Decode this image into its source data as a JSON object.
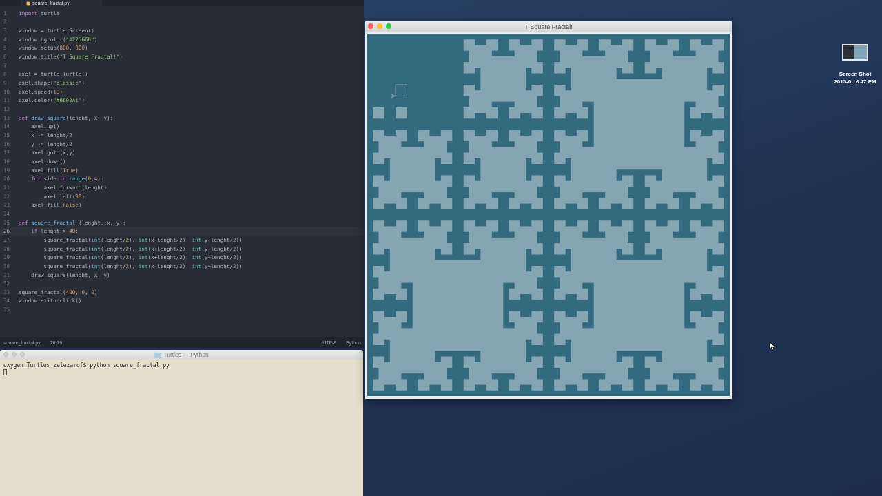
{
  "editor": {
    "tab": {
      "label": "square_fractal.py",
      "selected": true
    },
    "lines": [
      {
        "num": "1",
        "current": false,
        "tokens": [
          {
            "kind": "keyword",
            "text": "import"
          },
          {
            "kind": "plain",
            "text": " turtle"
          }
        ]
      },
      {
        "num": "2",
        "current": false
      },
      {
        "num": "3",
        "current": false,
        "tokens": [
          {
            "kind": "plain",
            "text": "window = turtle.Screen()"
          }
        ]
      },
      {
        "num": "4",
        "current": false,
        "tokens": [
          {
            "kind": "plain",
            "text": "window.bgcolor("
          },
          {
            "kind": "string",
            "text": "\"#27566B\""
          },
          {
            "kind": "plain",
            "text": ")"
          }
        ]
      },
      {
        "num": "5",
        "current": false,
        "tokens": [
          {
            "kind": "plain",
            "text": "window.setup("
          },
          {
            "kind": "number",
            "text": "800"
          },
          {
            "kind": "plain",
            "text": ", "
          },
          {
            "kind": "number",
            "text": "800"
          },
          {
            "kind": "plain",
            "text": ")"
          }
        ]
      },
      {
        "num": "6",
        "current": false,
        "tokens": [
          {
            "kind": "plain",
            "text": "window.title("
          },
          {
            "kind": "string",
            "text": "\"T Square Fractal!\""
          },
          {
            "kind": "plain",
            "text": ")"
          }
        ]
      },
      {
        "num": "7",
        "current": false
      },
      {
        "num": "8",
        "current": false,
        "tokens": [
          {
            "kind": "plain",
            "text": "axel = turtle.Turtle()"
          }
        ]
      },
      {
        "num": "9",
        "current": false,
        "tokens": [
          {
            "kind": "plain",
            "text": "axel.shape("
          },
          {
            "kind": "string",
            "text": "\"classic\""
          },
          {
            "kind": "plain",
            "text": ")"
          }
        ]
      },
      {
        "num": "10",
        "current": false,
        "tokens": [
          {
            "kind": "plain",
            "text": "axel.speed("
          },
          {
            "kind": "number",
            "text": "10"
          },
          {
            "kind": "plain",
            "text": ")"
          }
        ]
      },
      {
        "num": "11",
        "current": false,
        "tokens": [
          {
            "kind": "plain",
            "text": "axel.color("
          },
          {
            "kind": "string",
            "text": "\"#6E92A1\""
          },
          {
            "kind": "plain",
            "text": ")"
          }
        ]
      },
      {
        "num": "12",
        "current": false
      },
      {
        "num": "13",
        "current": false,
        "tokens": [
          {
            "kind": "keyword",
            "text": "def "
          },
          {
            "kind": "function",
            "text": "draw_square"
          },
          {
            "kind": "plain",
            "text": "(lenght, x, y):"
          }
        ]
      },
      {
        "num": "14",
        "current": false,
        "tokens": [
          {
            "kind": "plain",
            "text": "    axel.up()"
          }
        ]
      },
      {
        "num": "15",
        "current": false,
        "tokens": [
          {
            "kind": "plain",
            "text": "    x -= lenght/"
          },
          {
            "kind": "number",
            "text": "2"
          }
        ]
      },
      {
        "num": "16",
        "current": false,
        "tokens": [
          {
            "kind": "plain",
            "text": "    y -= lenght/"
          },
          {
            "kind": "number",
            "text": "2"
          }
        ]
      },
      {
        "num": "17",
        "current": false,
        "tokens": [
          {
            "kind": "plain",
            "text": "    axel.goto(x,y)"
          }
        ]
      },
      {
        "num": "18",
        "current": false,
        "tokens": [
          {
            "kind": "plain",
            "text": "    axel.down()"
          }
        ]
      },
      {
        "num": "19",
        "current": false,
        "tokens": [
          {
            "kind": "plain",
            "text": "    axel.fill("
          },
          {
            "kind": "number",
            "text": "True"
          },
          {
            "kind": "plain",
            "text": ")"
          }
        ]
      },
      {
        "num": "20",
        "current": false,
        "tokens": [
          {
            "kind": "keyword",
            "text": "    for"
          },
          {
            "kind": "plain",
            "text": " side "
          },
          {
            "kind": "keyword",
            "text": "in "
          },
          {
            "kind": "builtin",
            "text": "range"
          },
          {
            "kind": "plain",
            "text": "("
          },
          {
            "kind": "number",
            "text": "0"
          },
          {
            "kind": "plain",
            "text": ","
          },
          {
            "kind": "number",
            "text": "4"
          },
          {
            "kind": "plain",
            "text": "):"
          }
        ]
      },
      {
        "num": "21",
        "current": false,
        "tokens": [
          {
            "kind": "plain",
            "text": "        axel.forward(lenght)"
          }
        ]
      },
      {
        "num": "22",
        "current": false,
        "tokens": [
          {
            "kind": "plain",
            "text": "        axel.left("
          },
          {
            "kind": "number",
            "text": "90"
          },
          {
            "kind": "plain",
            "text": ")"
          }
        ]
      },
      {
        "num": "23",
        "current": false,
        "tokens": [
          {
            "kind": "plain",
            "text": "    axel.fill("
          },
          {
            "kind": "number",
            "text": "False"
          },
          {
            "kind": "plain",
            "text": ")"
          }
        ]
      },
      {
        "num": "24",
        "current": false
      },
      {
        "num": "25",
        "current": false,
        "tokens": [
          {
            "kind": "keyword",
            "text": "def "
          },
          {
            "kind": "function",
            "text": "square_fractal"
          },
          {
            "kind": "plain",
            "text": " (lenght, x, y):"
          }
        ]
      },
      {
        "num": "26",
        "current": true,
        "tokens": [
          {
            "kind": "keyword",
            "text": "    if"
          },
          {
            "kind": "plain",
            "text": " lenght > "
          },
          {
            "kind": "number",
            "text": "40"
          },
          {
            "kind": "plain",
            "text": ":"
          }
        ]
      },
      {
        "num": "27",
        "current": false,
        "tokens": [
          {
            "kind": "plain",
            "text": "        square_fractal("
          },
          {
            "kind": "builtin",
            "text": "int"
          },
          {
            "kind": "plain",
            "text": "(lenght/"
          },
          {
            "kind": "number",
            "text": "2"
          },
          {
            "kind": "plain",
            "text": "), "
          },
          {
            "kind": "builtin",
            "text": "int"
          },
          {
            "kind": "plain",
            "text": "(x-lenght/"
          },
          {
            "kind": "number",
            "text": "2"
          },
          {
            "kind": "plain",
            "text": "), "
          },
          {
            "kind": "builtin",
            "text": "int"
          },
          {
            "kind": "plain",
            "text": "(y-lenght/"
          },
          {
            "kind": "number",
            "text": "2"
          },
          {
            "kind": "plain",
            "text": "))"
          }
        ]
      },
      {
        "num": "28",
        "current": false,
        "tokens": [
          {
            "kind": "plain",
            "text": "        square_fractal("
          },
          {
            "kind": "builtin",
            "text": "int"
          },
          {
            "kind": "plain",
            "text": "(lenght/"
          },
          {
            "kind": "number",
            "text": "2"
          },
          {
            "kind": "plain",
            "text": "), "
          },
          {
            "kind": "builtin",
            "text": "int"
          },
          {
            "kind": "plain",
            "text": "(x+lenght/"
          },
          {
            "kind": "number",
            "text": "2"
          },
          {
            "kind": "plain",
            "text": "), "
          },
          {
            "kind": "builtin",
            "text": "int"
          },
          {
            "kind": "plain",
            "text": "(y-lenght/"
          },
          {
            "kind": "number",
            "text": "2"
          },
          {
            "kind": "plain",
            "text": "))"
          }
        ]
      },
      {
        "num": "29",
        "current": false,
        "tokens": [
          {
            "kind": "plain",
            "text": "        square_fractal("
          },
          {
            "kind": "builtin",
            "text": "int"
          },
          {
            "kind": "plain",
            "text": "(lenght/"
          },
          {
            "kind": "number",
            "text": "2"
          },
          {
            "kind": "plain",
            "text": "), "
          },
          {
            "kind": "builtin",
            "text": "int"
          },
          {
            "kind": "plain",
            "text": "(x+lenght/"
          },
          {
            "kind": "number",
            "text": "2"
          },
          {
            "kind": "plain",
            "text": "), "
          },
          {
            "kind": "builtin",
            "text": "int"
          },
          {
            "kind": "plain",
            "text": "(y+lenght/"
          },
          {
            "kind": "number",
            "text": "2"
          },
          {
            "kind": "plain",
            "text": "))"
          }
        ]
      },
      {
        "num": "30",
        "current": false,
        "tokens": [
          {
            "kind": "plain",
            "text": "        square_fractal("
          },
          {
            "kind": "builtin",
            "text": "int"
          },
          {
            "kind": "plain",
            "text": "(lenght/"
          },
          {
            "kind": "number",
            "text": "2"
          },
          {
            "kind": "plain",
            "text": "), "
          },
          {
            "kind": "builtin",
            "text": "int"
          },
          {
            "kind": "plain",
            "text": "(x-lenght/"
          },
          {
            "kind": "number",
            "text": "2"
          },
          {
            "kind": "plain",
            "text": "), "
          },
          {
            "kind": "builtin",
            "text": "int"
          },
          {
            "kind": "plain",
            "text": "(y+lenght/"
          },
          {
            "kind": "number",
            "text": "2"
          },
          {
            "kind": "plain",
            "text": "))"
          }
        ]
      },
      {
        "num": "31",
        "current": false,
        "tokens": [
          {
            "kind": "plain",
            "text": "    draw_square(lenght, x, y)"
          }
        ]
      },
      {
        "num": "32",
        "current": false
      },
      {
        "num": "33",
        "current": false,
        "tokens": [
          {
            "kind": "plain",
            "text": "square_fractal("
          },
          {
            "kind": "number",
            "text": "400"
          },
          {
            "kind": "plain",
            "text": ", "
          },
          {
            "kind": "number",
            "text": "0"
          },
          {
            "kind": "plain",
            "text": ", "
          },
          {
            "kind": "number",
            "text": "0"
          },
          {
            "kind": "plain",
            "text": ")"
          }
        ]
      },
      {
        "num": "34",
        "current": false,
        "tokens": [
          {
            "kind": "plain",
            "text": "window.exitonclick()"
          }
        ]
      },
      {
        "num": "35",
        "current": false
      }
    ]
  },
  "status_bar": {
    "file": "square_fractal.py",
    "position": "26:19",
    "encoding": "UTF-8",
    "language": "Python"
  },
  "terminal": {
    "title": "Turtles — Python",
    "lines": [
      "oxygen:Turtles zelezarof$ python square_fractal.py"
    ]
  },
  "turtle_window": {
    "title": "T Square Fractal!"
  },
  "desktop_icon": {
    "label_1": "Screen Shot",
    "label_2": "2015-0...6.47 PM"
  }
}
